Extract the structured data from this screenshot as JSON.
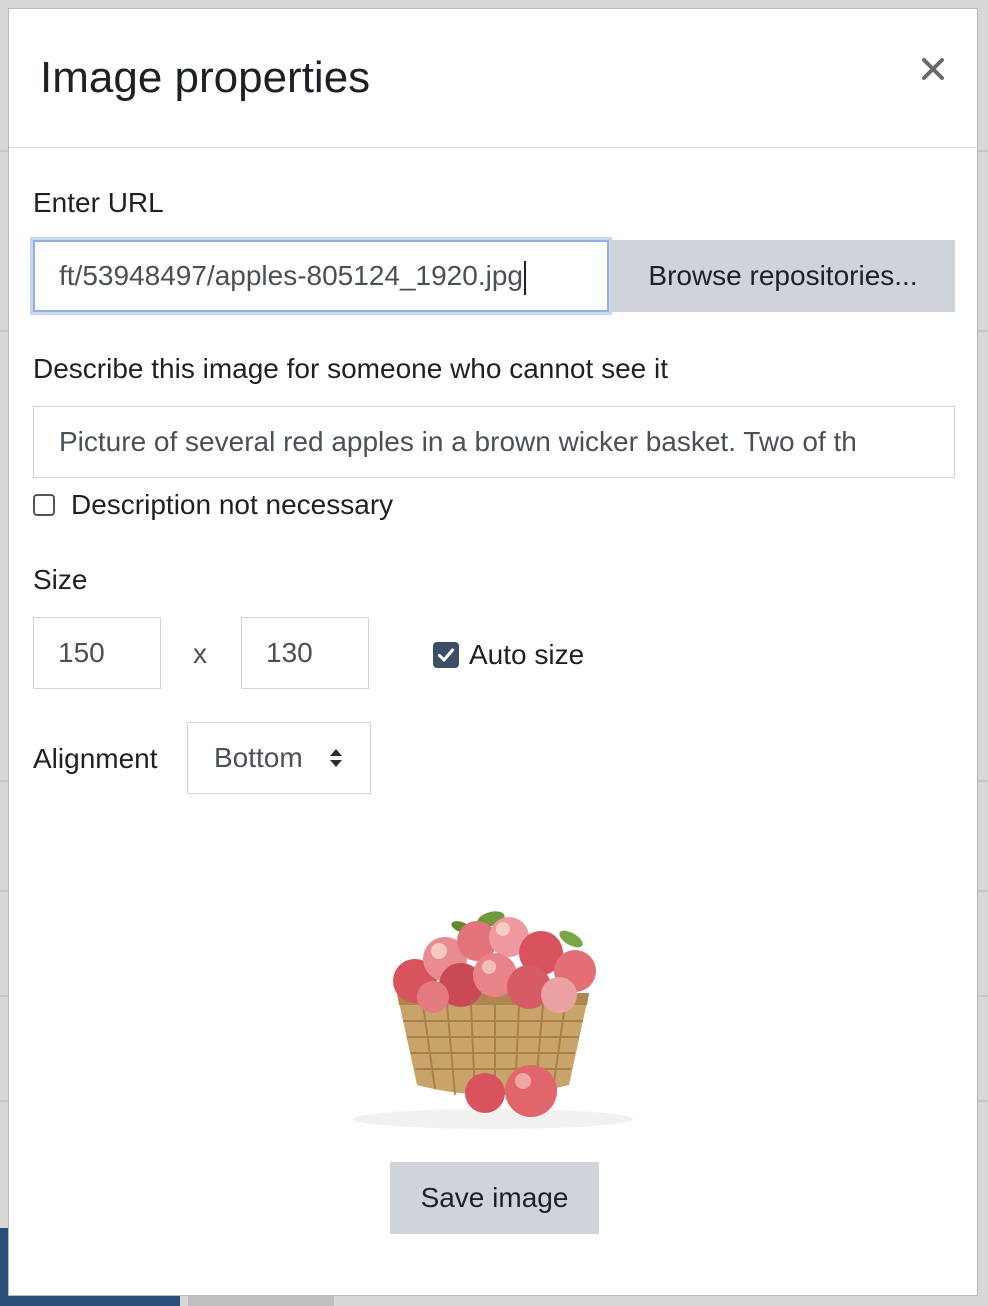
{
  "dialog": {
    "title": "Image properties",
    "close_icon": "close-icon"
  },
  "url": {
    "label": "Enter URL",
    "value": "ft/53948497/apples-805124_1920.jpg",
    "browse_label": "Browse repositories..."
  },
  "description": {
    "label": "Describe this image for someone who cannot see it",
    "value": "Picture of several red apples in a brown wicker basket. Two of th",
    "not_necessary_label": "Description not necessary",
    "not_necessary_checked": false
  },
  "size": {
    "label": "Size",
    "width": "150",
    "separator": "x",
    "height": "130",
    "auto_size_label": "Auto size",
    "auto_size_checked": true
  },
  "alignment": {
    "label": "Alignment",
    "selected": "Bottom"
  },
  "preview": {
    "icon": "apple-basket-image"
  },
  "actions": {
    "save_label": "Save image"
  },
  "colors": {
    "accent": "#3c4f66",
    "button_bg": "#ced4da",
    "focus_border": "#8fb1e6"
  }
}
